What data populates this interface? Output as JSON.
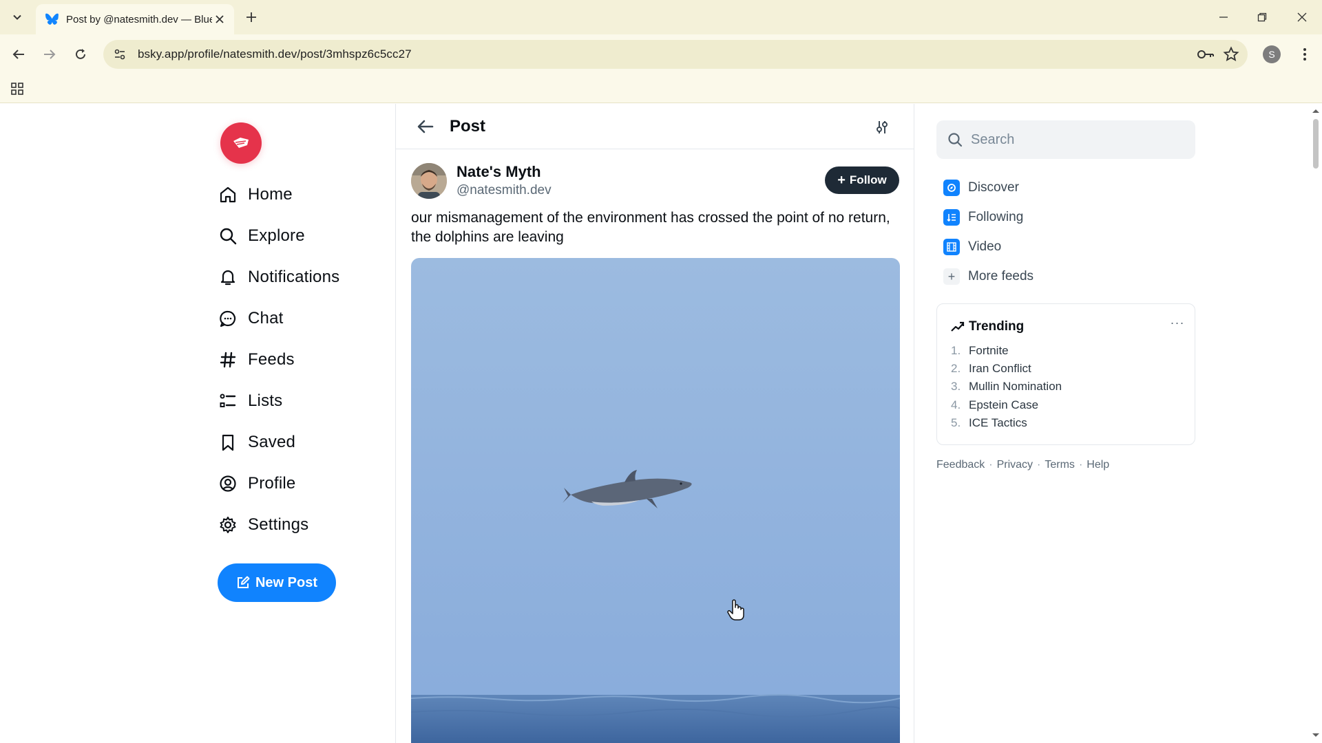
{
  "browser": {
    "tab_title": "Post by @natesmith.dev — Bluesky",
    "url": "bsky.app/profile/natesmith.dev/post/3mhspz6c5cc27",
    "profile_initial": "S"
  },
  "nav": {
    "items": [
      {
        "label": "Home",
        "icon": "home-icon"
      },
      {
        "label": "Explore",
        "icon": "search-icon"
      },
      {
        "label": "Notifications",
        "icon": "bell-icon"
      },
      {
        "label": "Chat",
        "icon": "chat-icon"
      },
      {
        "label": "Feeds",
        "icon": "hash-icon"
      },
      {
        "label": "Lists",
        "icon": "list-icon"
      },
      {
        "label": "Saved",
        "icon": "bookmark-icon"
      },
      {
        "label": "Profile",
        "icon": "user-circle-icon"
      },
      {
        "label": "Settings",
        "icon": "gear-icon"
      }
    ],
    "new_post_label": "New Post"
  },
  "post": {
    "header_title": "Post",
    "author_name": "Nate's Myth",
    "author_handle": "@natesmith.dev",
    "follow_label": "Follow",
    "text": "our mismanagement of the environment has crossed the point of no return, the dolphins are leaving"
  },
  "right": {
    "search_placeholder": "Search",
    "feeds": [
      {
        "label": "Discover",
        "icon": "discover-icon"
      },
      {
        "label": "Following",
        "icon": "following-icon"
      },
      {
        "label": "Video",
        "icon": "video-icon"
      }
    ],
    "more_feeds_label": "More feeds",
    "trending_title": "Trending",
    "trending": [
      {
        "num": "1.",
        "label": "Fortnite"
      },
      {
        "num": "2.",
        "label": "Iran Conflict"
      },
      {
        "num": "3.",
        "label": "Mullin Nomination"
      },
      {
        "num": "4.",
        "label": "Epstein Case"
      },
      {
        "num": "5.",
        "label": "ICE Tactics"
      }
    ],
    "footer": [
      "Feedback",
      "Privacy",
      "Terms",
      "Help"
    ]
  },
  "colors": {
    "accent": "#1083fe",
    "logo": "#e5334b",
    "follow_bg": "#1e2a36",
    "chrome_bg": "#fbf9ea"
  }
}
